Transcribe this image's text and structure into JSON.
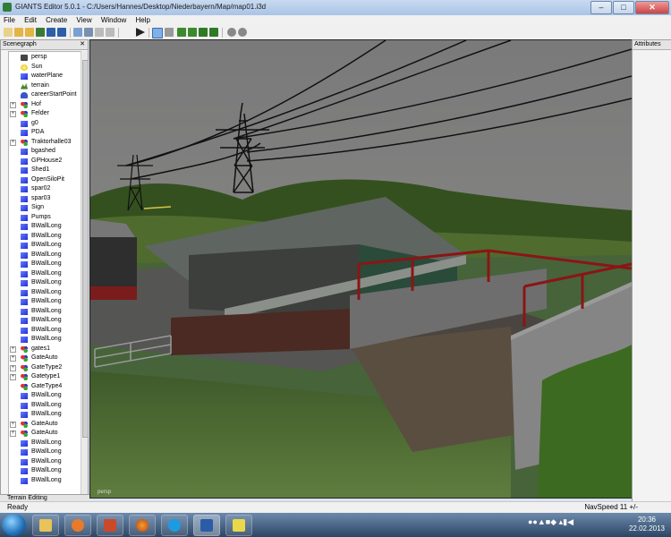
{
  "window": {
    "title": "GIANTS Editor 5.0.1 - C:/Users/Hannes/Desktop/Niederbayern/Map/map01.i3d"
  },
  "menu": [
    "File",
    "Edit",
    "Create",
    "View",
    "Window",
    "Help"
  ],
  "scenegraph": {
    "title": "Scenegraph",
    "close": "✕",
    "items": [
      {
        "label": "persp",
        "icon": "camera-icon",
        "expand": ""
      },
      {
        "label": "Sun",
        "icon": "light-icon",
        "expand": ""
      },
      {
        "label": "waterPlane",
        "icon": "cube-icon",
        "expand": ""
      },
      {
        "label": "terrain",
        "icon": "terrain-icon",
        "expand": ""
      },
      {
        "label": "careerStartPoint",
        "icon": "person-icon",
        "expand": ""
      },
      {
        "label": "Hof",
        "icon": "group-icon",
        "expand": "+"
      },
      {
        "label": "Felder",
        "icon": "group-icon",
        "expand": "+"
      },
      {
        "label": "g0",
        "icon": "cube-icon",
        "expand": ""
      },
      {
        "label": "PDA",
        "icon": "cube-icon",
        "expand": ""
      },
      {
        "label": "Traktorhalle03",
        "icon": "group-icon",
        "expand": "+"
      },
      {
        "label": "bgashed",
        "icon": "cube-icon",
        "expand": ""
      },
      {
        "label": "GPHouse2",
        "icon": "cube-icon",
        "expand": ""
      },
      {
        "label": "Shed1",
        "icon": "cube-icon",
        "expand": ""
      },
      {
        "label": "OpenSiloPit",
        "icon": "cube-icon",
        "expand": ""
      },
      {
        "label": "spar02",
        "icon": "cube-icon",
        "expand": ""
      },
      {
        "label": "spar03",
        "icon": "cube-icon",
        "expand": ""
      },
      {
        "label": "Sign",
        "icon": "cube-icon",
        "expand": ""
      },
      {
        "label": "Pumps",
        "icon": "cube-icon",
        "expand": ""
      },
      {
        "label": "BWallLong",
        "icon": "cube-icon",
        "expand": ""
      },
      {
        "label": "BWallLong",
        "icon": "cube-icon",
        "expand": ""
      },
      {
        "label": "BWallLong",
        "icon": "cube-icon",
        "expand": ""
      },
      {
        "label": "BWallLong",
        "icon": "cube-icon",
        "expand": ""
      },
      {
        "label": "BWallLong",
        "icon": "cube-icon",
        "expand": ""
      },
      {
        "label": "BWallLong",
        "icon": "cube-icon",
        "expand": ""
      },
      {
        "label": "BWallLong",
        "icon": "cube-icon",
        "expand": ""
      },
      {
        "label": "BWallLong",
        "icon": "cube-icon",
        "expand": ""
      },
      {
        "label": "BWallLong",
        "icon": "cube-icon",
        "expand": ""
      },
      {
        "label": "BWallLong",
        "icon": "cube-icon",
        "expand": ""
      },
      {
        "label": "BWallLong",
        "icon": "cube-icon",
        "expand": ""
      },
      {
        "label": "BWallLong",
        "icon": "cube-icon",
        "expand": ""
      },
      {
        "label": "BWallLong",
        "icon": "cube-icon",
        "expand": ""
      },
      {
        "label": "gates1",
        "icon": "group-icon",
        "expand": "+"
      },
      {
        "label": "GateAuto",
        "icon": "group-icon",
        "expand": "+"
      },
      {
        "label": "GateType2",
        "icon": "group-icon",
        "expand": "+"
      },
      {
        "label": "Gatetype1",
        "icon": "group-icon",
        "expand": "+"
      },
      {
        "label": "GateType4",
        "icon": "group-icon",
        "expand": ""
      },
      {
        "label": "BWallLong",
        "icon": "cube-icon",
        "expand": ""
      },
      {
        "label": "BWallLong",
        "icon": "cube-icon",
        "expand": ""
      },
      {
        "label": "BWallLong",
        "icon": "cube-icon",
        "expand": ""
      },
      {
        "label": "GateAuto",
        "icon": "group-icon",
        "expand": "+"
      },
      {
        "label": "GateAuto",
        "icon": "group-icon",
        "expand": "+"
      },
      {
        "label": "BWallLong",
        "icon": "cube-icon",
        "expand": ""
      },
      {
        "label": "BWallLong",
        "icon": "cube-icon",
        "expand": ""
      },
      {
        "label": "BWallLong",
        "icon": "cube-icon",
        "expand": ""
      },
      {
        "label": "BWallLong",
        "icon": "cube-icon",
        "expand": ""
      },
      {
        "label": "BWallLong",
        "icon": "cube-icon",
        "expand": ""
      }
    ]
  },
  "terrain_panel": {
    "title": "Terrain Editing"
  },
  "attributes_panel": {
    "title": "Attributes"
  },
  "viewport": {
    "camera_label": "persp"
  },
  "status": {
    "left": "Ready",
    "right": "NavSpeed 11 +/-"
  },
  "taskbar": {
    "tray": "●●▲■◆ ▴▮◀",
    "time": "20:36",
    "date": "22.02.2013"
  }
}
